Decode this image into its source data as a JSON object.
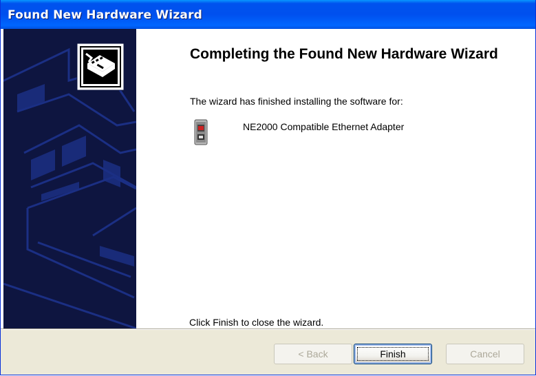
{
  "window": {
    "title": "Found New Hardware Wizard"
  },
  "main": {
    "heading": "Completing the Found New Hardware Wizard",
    "subtext": "The wizard has finished installing the software for:",
    "device_name": "NE2000 Compatible Ethernet Adapter",
    "closing_text": "Click Finish to close the wizard."
  },
  "buttons": {
    "back_label": "< Back",
    "finish_label": "Finish",
    "cancel_label": "Cancel"
  },
  "icons": {
    "wizard": "hardware-wizard-icon",
    "device": "network-adapter-icon"
  },
  "colors": {
    "title_bar": "#0053ee",
    "sidebar": "#0e1540",
    "dialog_background": "#ece9d8"
  }
}
